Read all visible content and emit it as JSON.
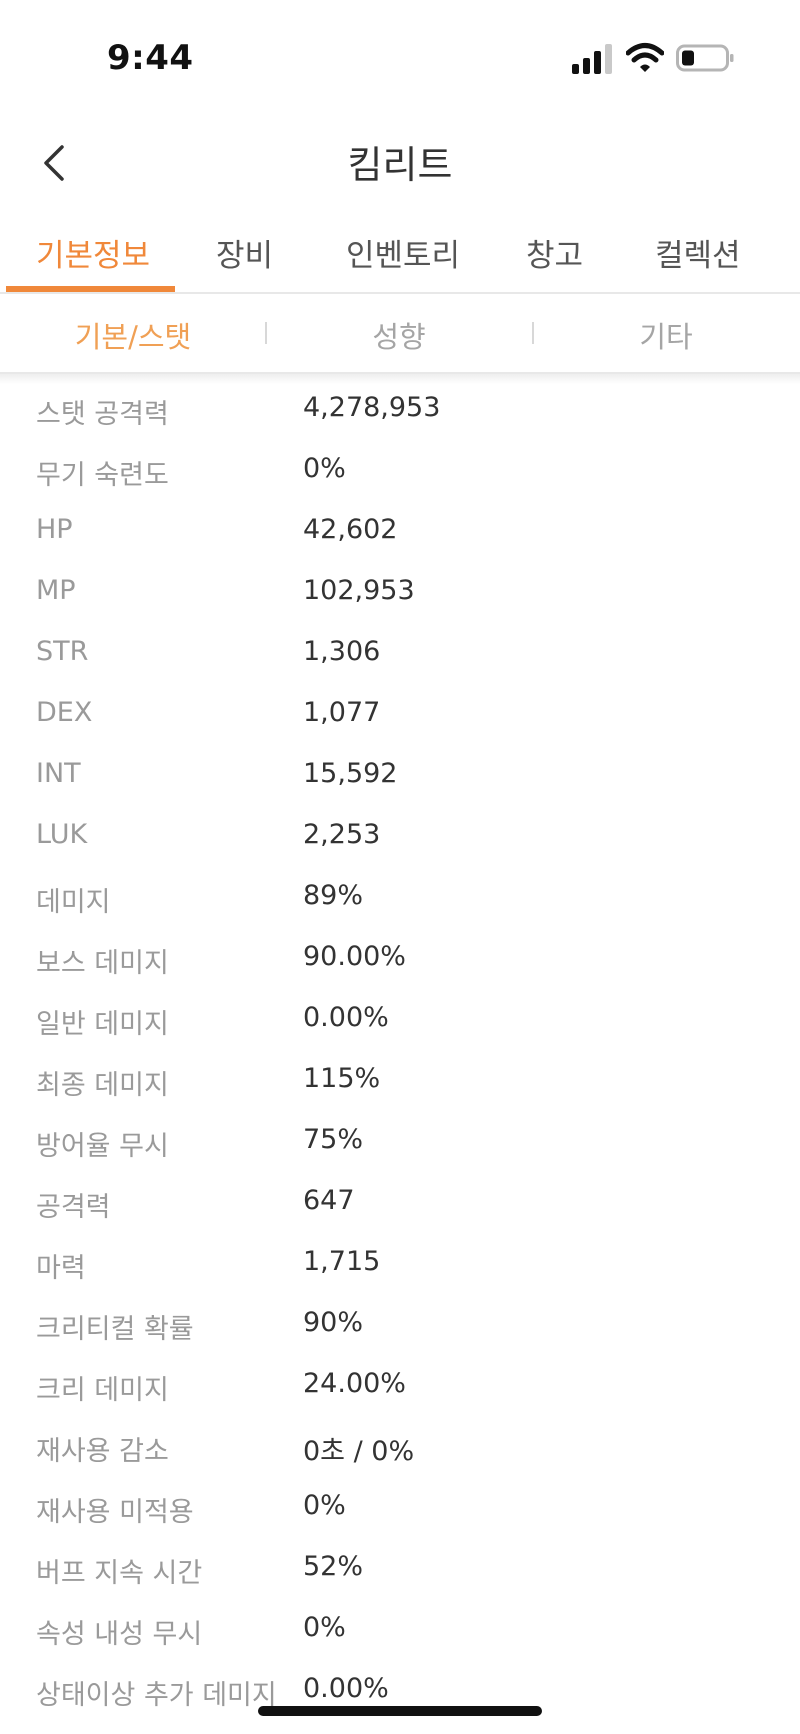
{
  "status_bar": {
    "time": "9:44",
    "icons": [
      "signal-icon",
      "wifi-icon",
      "battery-icon"
    ]
  },
  "nav": {
    "title": "킴리트",
    "back_icon": "chevron-left-icon"
  },
  "main_tabs": [
    {
      "label": "기본정보",
      "active": true
    },
    {
      "label": "장비",
      "active": false
    },
    {
      "label": "인벤토리",
      "active": false
    },
    {
      "label": "창고",
      "active": false
    },
    {
      "label": "컬렉션",
      "active": false
    }
  ],
  "sub_tabs": [
    {
      "label": "기본/스탯",
      "active": true
    },
    {
      "label": "성향",
      "active": false
    },
    {
      "label": "기타",
      "active": false
    }
  ],
  "stats": [
    {
      "label": "스탯 공격력",
      "value": "4,278,953"
    },
    {
      "label": "무기 숙련도",
      "value": "0%"
    },
    {
      "label": "HP",
      "value": "42,602"
    },
    {
      "label": "MP",
      "value": "102,953"
    },
    {
      "label": "STR",
      "value": "1,306"
    },
    {
      "label": "DEX",
      "value": "1,077"
    },
    {
      "label": "INT",
      "value": "15,592"
    },
    {
      "label": "LUK",
      "value": "2,253"
    },
    {
      "label": "데미지",
      "value": "89%"
    },
    {
      "label": "보스 데미지",
      "value": "90.00%"
    },
    {
      "label": "일반 데미지",
      "value": "0.00%"
    },
    {
      "label": "최종 데미지",
      "value": "115%"
    },
    {
      "label": "방어율 무시",
      "value": "75%"
    },
    {
      "label": "공격력",
      "value": "647"
    },
    {
      "label": "마력",
      "value": "1,715"
    },
    {
      "label": "크리티컬 확률",
      "value": "90%"
    },
    {
      "label": "크리 데미지",
      "value": "24.00%"
    },
    {
      "label": "재사용 감소",
      "value": "0초 / 0%"
    },
    {
      "label": "재사용 미적용",
      "value": "0%"
    },
    {
      "label": "버프 지속 시간",
      "value": "52%"
    },
    {
      "label": "속성 내성 무시",
      "value": "0%"
    },
    {
      "label": "상태이상 추가 데미지",
      "value": "0.00%"
    }
  ],
  "colors": {
    "accent": "#f0883a",
    "label": "#9a9a9a",
    "value": "#333333"
  }
}
